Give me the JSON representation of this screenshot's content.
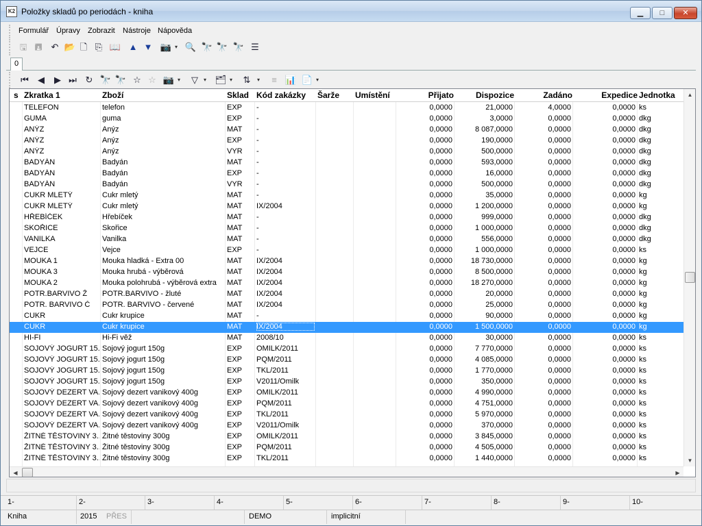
{
  "window": {
    "title": "Položky skladů po periodách - kniha",
    "app_icon_text": "K2"
  },
  "menu": [
    "Formulář",
    "Úpravy",
    "Zobrazit",
    "Nástroje",
    "Nápověda"
  ],
  "tab_label": "0",
  "columns": [
    "s",
    "Zkratka 1",
    "Zboží",
    "Sklad",
    "Kód zakázky",
    "Šarže",
    "Umístění",
    "Přijato",
    "Dispozice",
    "Zadáno",
    "Expedice",
    "Jednotka"
  ],
  "rows": [
    [
      "",
      "TELEFON",
      "telefon",
      "EXP",
      "-",
      "",
      "",
      "0,0000",
      "21,0000",
      "4,0000",
      "0,0000",
      "ks"
    ],
    [
      "",
      "GUMA",
      "guma",
      "EXP",
      "-",
      "",
      "",
      "0,0000",
      "3,0000",
      "0,0000",
      "0,0000",
      "dkg"
    ],
    [
      "",
      "ANÝZ",
      "Anýz",
      "MAT",
      "-",
      "",
      "",
      "0,0000",
      "8 087,0000",
      "0,0000",
      "0,0000",
      "dkg"
    ],
    [
      "",
      "ANÝZ",
      "Anýz",
      "EXP",
      "-",
      "",
      "",
      "0,0000",
      "190,0000",
      "0,0000",
      "0,0000",
      "dkg"
    ],
    [
      "",
      "ANÝZ",
      "Anýz",
      "VYR",
      "-",
      "",
      "",
      "0,0000",
      "500,0000",
      "0,0000",
      "0,0000",
      "dkg"
    ],
    [
      "",
      "BADYÁN",
      "Badyán",
      "MAT",
      "-",
      "",
      "",
      "0,0000",
      "593,0000",
      "0,0000",
      "0,0000",
      "dkg"
    ],
    [
      "",
      "BADYÁN",
      "Badyán",
      "EXP",
      "-",
      "",
      "",
      "0,0000",
      "16,0000",
      "0,0000",
      "0,0000",
      "dkg"
    ],
    [
      "",
      "BADYÁN",
      "Badyán",
      "VYR",
      "-",
      "",
      "",
      "0,0000",
      "500,0000",
      "0,0000",
      "0,0000",
      "dkg"
    ],
    [
      "",
      "CUKR MLETÝ",
      "Cukr mletý",
      "MAT",
      "-",
      "",
      "",
      "0,0000",
      "35,0000",
      "0,0000",
      "0,0000",
      "kg"
    ],
    [
      "",
      "CUKR MLETÝ",
      "Cukr mletý",
      "MAT",
      "IX/2004",
      "",
      "",
      "0,0000",
      "1 200,0000",
      "0,0000",
      "0,0000",
      "kg"
    ],
    [
      "",
      "HŘEBÍČEK",
      "Hřebíček",
      "MAT",
      "-",
      "",
      "",
      "0,0000",
      "999,0000",
      "0,0000",
      "0,0000",
      "dkg"
    ],
    [
      "",
      "SKOŘICE",
      "Skořice",
      "MAT",
      "-",
      "",
      "",
      "0,0000",
      "1 000,0000",
      "0,0000",
      "0,0000",
      "dkg"
    ],
    [
      "",
      "VANILKA",
      "Vanilka",
      "MAT",
      "-",
      "",
      "",
      "0,0000",
      "556,0000",
      "0,0000",
      "0,0000",
      "dkg"
    ],
    [
      "",
      "VEJCE",
      "Vejce",
      "EXP",
      "-",
      "",
      "",
      "0,0000",
      "1 000,0000",
      "0,0000",
      "0,0000",
      "ks"
    ],
    [
      "",
      "MOUKA 1",
      "Mouka hladká - Extra 00",
      "MAT",
      "IX/2004",
      "",
      "",
      "0,0000",
      "18 730,0000",
      "0,0000",
      "0,0000",
      "kg"
    ],
    [
      "",
      "MOUKA 3",
      "Mouka hrubá - výběrová",
      "MAT",
      "IX/2004",
      "",
      "",
      "0,0000",
      "8 500,0000",
      "0,0000",
      "0,0000",
      "kg"
    ],
    [
      "",
      "MOUKA 2",
      "Mouka polohrubá - výběrová  extra",
      "MAT",
      "IX/2004",
      "",
      "",
      "0,0000",
      "18 270,0000",
      "0,0000",
      "0,0000",
      "kg"
    ],
    [
      "",
      "POTR.BARVIVO Ž",
      "POTR.BARVIVO - žluté",
      "MAT",
      "IX/2004",
      "",
      "",
      "0,0000",
      "20,0000",
      "0,0000",
      "0,0000",
      "kg"
    ],
    [
      "",
      "POTR. BARVIVO Č",
      "POTR. BARVIVO - červené",
      "MAT",
      "IX/2004",
      "",
      "",
      "0,0000",
      "25,0000",
      "0,0000",
      "0,0000",
      "kg"
    ],
    [
      "",
      "CUKR",
      "Cukr krupice",
      "MAT",
      "-",
      "",
      "",
      "0,0000",
      "90,0000",
      "0,0000",
      "0,0000",
      "kg"
    ],
    [
      "",
      "CUKR",
      "Cukr krupice",
      "MAT",
      "IX/2004",
      "",
      "",
      "0,0000",
      "1 500,0000",
      "0,0000",
      "0,0000",
      "kg"
    ],
    [
      "",
      "HI-FI",
      "Hi-Fi věž",
      "MAT",
      "2008/10",
      "",
      "",
      "0,0000",
      "30,0000",
      "0,0000",
      "0,0000",
      "ks"
    ],
    [
      "",
      "SOJOVÝ JOGURT 15...",
      "Sojový jogurt 150g",
      "EXP",
      "OMILK/2011",
      "",
      "",
      "0,0000",
      "7 770,0000",
      "0,0000",
      "0,0000",
      "ks"
    ],
    [
      "",
      "SOJOVÝ JOGURT 15...",
      "Sojový jogurt 150g",
      "EXP",
      "PQM/2011",
      "",
      "",
      "0,0000",
      "4 085,0000",
      "0,0000",
      "0,0000",
      "ks"
    ],
    [
      "",
      "SOJOVÝ JOGURT 15...",
      "Sojový jogurt 150g",
      "EXP",
      "TKL/2011",
      "",
      "",
      "0,0000",
      "1 770,0000",
      "0,0000",
      "0,0000",
      "ks"
    ],
    [
      "",
      "SOJOVÝ JOGURT 15...",
      "Sojový jogurt 150g",
      "EXP",
      "V2011/Omilk",
      "",
      "",
      "0,0000",
      "350,0000",
      "0,0000",
      "0,0000",
      "ks"
    ],
    [
      "",
      "SOJOVÝ DEZERT VA...",
      "Sojový dezert vanikový 400g",
      "EXP",
      "OMILK/2011",
      "",
      "",
      "0,0000",
      "4 990,0000",
      "0,0000",
      "0,0000",
      "ks"
    ],
    [
      "",
      "SOJOVÝ DEZERT VA...",
      "Sojový dezert vanikový 400g",
      "EXP",
      "PQM/2011",
      "",
      "",
      "0,0000",
      "4 751,0000",
      "0,0000",
      "0,0000",
      "ks"
    ],
    [
      "",
      "SOJOVÝ DEZERT VA...",
      "Sojový dezert vanikový 400g",
      "EXP",
      "TKL/2011",
      "",
      "",
      "0,0000",
      "5 970,0000",
      "0,0000",
      "0,0000",
      "ks"
    ],
    [
      "",
      "SOJOVÝ DEZERT VA...",
      "Sojový dezert vanikový 400g",
      "EXP",
      "V2011/Omilk",
      "",
      "",
      "0,0000",
      "370,0000",
      "0,0000",
      "0,0000",
      "ks"
    ],
    [
      "",
      "ŽITNÉ TĚSTOVINY 3...",
      "Žitné těstoviny 300g",
      "EXP",
      "OMILK/2011",
      "",
      "",
      "0,0000",
      "3 845,0000",
      "0,0000",
      "0,0000",
      "ks"
    ],
    [
      "",
      "ŽITNÉ TĚSTOVINY 3...",
      "Žitné těstoviny 300g",
      "EXP",
      "PQM/2011",
      "",
      "",
      "0,0000",
      "4 505,0000",
      "0,0000",
      "0,0000",
      "ks"
    ],
    [
      "",
      "ŽITNÉ TĚSTOVINY 3...",
      "Žitné těstoviny 300g",
      "EXP",
      "TKL/2011",
      "",
      "",
      "0,0000",
      "1 440,0000",
      "0,0000",
      "0,0000",
      "ks"
    ]
  ],
  "selected_row": 20,
  "fkeys": [
    "1-",
    "2-",
    "3-",
    "4-",
    "5-",
    "6-",
    "7-",
    "8-",
    "9-",
    "10-"
  ],
  "status": {
    "book": "Kniha",
    "year": "2015",
    "flag": "PŘES",
    "db": "DEMO",
    "profile": "implicitní"
  },
  "colors": {
    "selection": "#3399ff",
    "title_gradient": "#c3d6ec"
  }
}
